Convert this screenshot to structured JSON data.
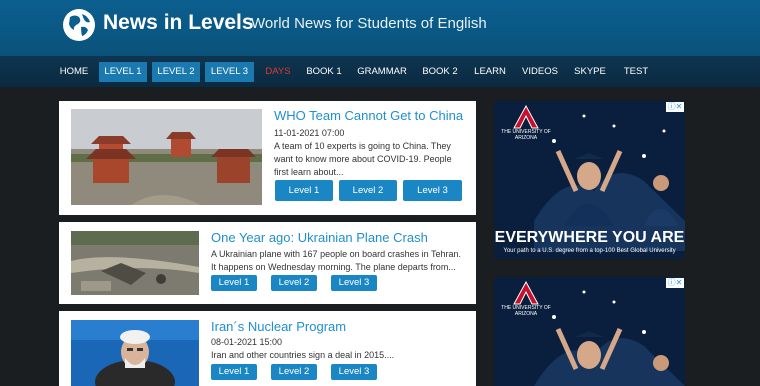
{
  "header": {
    "site_title": "News in Levels",
    "tagline": "World News for Students of English"
  },
  "nav": {
    "items": [
      "HOME",
      "LEVEL 1",
      "LEVEL 2",
      "LEVEL 3",
      "DAYS",
      "BOOK 1",
      "GRAMMAR",
      "BOOK 2",
      "LEARN",
      "VIDEOS",
      "SKYPE",
      "TEST"
    ]
  },
  "articles": [
    {
      "title": "WHO Team Cannot Get to China",
      "date": "11-01-2021 07:00",
      "excerpt": "A team of 10 experts is going to China. They want to know more about COVID-19. People first learn about...",
      "levels": [
        "Level 1",
        "Level 2",
        "Level 3"
      ]
    },
    {
      "title": "One Year ago: Ukrainian Plane Crash",
      "excerpt": "A Ukrainian plane with 167 people on board crashes in Tehran. It happens on Wednesday morning. The plane departs from...",
      "levels": [
        "Level 1",
        "Level 2",
        "Level 3"
      ]
    },
    {
      "title": "Iran´s Nuclear Program",
      "date": "08-01-2021 15:00",
      "excerpt": "Iran and other countries sign a deal in 2015....",
      "levels": [
        "Level 1",
        "Level 2",
        "Level 3"
      ]
    }
  ],
  "ads": [
    {
      "logo_text": "THE UNIVERSITY OF ARIZONA",
      "headline": "EVERYWHERE YOU ARE",
      "subtext": "Your path to a U.S. degree from a top-100 Best Global University"
    },
    {
      "logo_text": "THE UNIVERSITY OF ARIZONA"
    }
  ],
  "colors": {
    "header": "#0b5f8f",
    "nav": "#0e3550",
    "accent": "#1b86c4",
    "days": "#e03a2e",
    "background": "#1b1e21"
  }
}
